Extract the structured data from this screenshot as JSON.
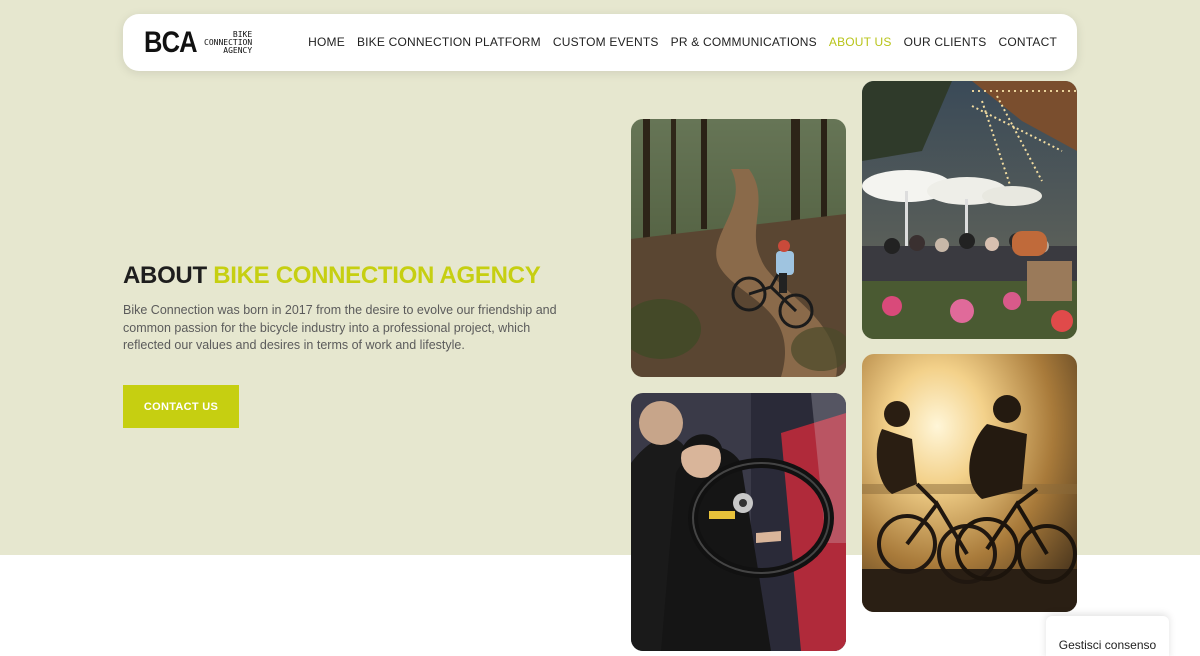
{
  "brand": {
    "logo_mark": "BCA",
    "logo_line1": "BIKE",
    "logo_line2": "CONNECTION",
    "logo_line3": "AGENCY"
  },
  "nav": {
    "items": [
      {
        "label": "HOME",
        "active": false
      },
      {
        "label": "BIKE CONNECTION PLATFORM",
        "active": false
      },
      {
        "label": "CUSTOM EVENTS",
        "active": false
      },
      {
        "label": "PR & COMMUNICATIONS",
        "active": false
      },
      {
        "label": "ABOUT US",
        "active": true
      },
      {
        "label": "OUR CLIENTS",
        "active": false
      },
      {
        "label": "CONTACT",
        "active": false
      }
    ]
  },
  "hero": {
    "title_prefix": "ABOUT ",
    "title_accent": "BIKE CONNECTION AGENCY",
    "intro": "Bike Connection was born in 2017 from the desire to evolve our friendship and common passion for the bicycle industry into a professional project, which reflected our values and desires in terms of work and lifestyle.",
    "cta_label": "CONTACT US"
  },
  "consent": {
    "label": "Gestisci consenso"
  },
  "colors": {
    "accent": "#c6cf11",
    "hero_background": "#e6e7cf",
    "text_dark": "#1e1e1e",
    "text_body": "#5b5b5b"
  }
}
